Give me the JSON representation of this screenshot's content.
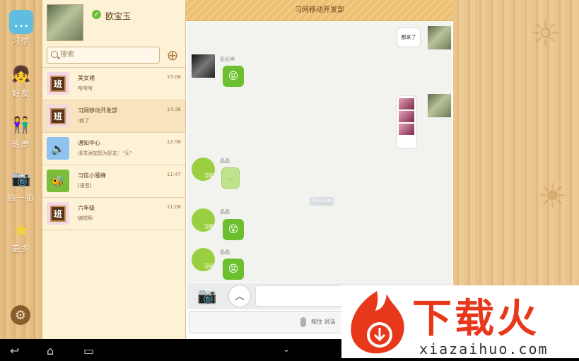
{
  "nav": {
    "items": [
      {
        "label": "习信",
        "icon": "chat-bubble-icon"
      },
      {
        "label": "好友",
        "icon": "girl-avatar-icon"
      },
      {
        "label": "班群",
        "icon": "group-avatar-icon"
      },
      {
        "label": "拍一拍",
        "icon": "camera-icon"
      },
      {
        "label": "更多",
        "icon": "star-icon"
      }
    ],
    "settings_icon": "gear-icon"
  },
  "profile": {
    "name": "欧宝玉",
    "search_placeholder": "搜索"
  },
  "conversations": [
    {
      "name": "美女裙",
      "time": "15:06",
      "preview": "哈哈哈",
      "avatar": "班"
    },
    {
      "name": "习网移动开发部",
      "time": "14:36",
      "preview": "/疯了",
      "avatar": "班"
    },
    {
      "name": "通知中心",
      "time": "12:56",
      "preview": "请求添加您为好友：\"无\"",
      "avatar": "speaker-icon"
    },
    {
      "name": "习信小蜜蜂",
      "time": "11:47",
      "preview": "[语音]",
      "avatar": "bee-icon"
    },
    {
      "name": "六年级",
      "time": "11:06",
      "preview": "嗨啦啊",
      "avatar": "班"
    }
  ],
  "chat": {
    "title": "习网移动开发部",
    "messages": {
      "m1_text": "都来了",
      "m2_sender": "彭长坤",
      "m4_sender": "晶晶",
      "m4_text": "...",
      "time_chip": "今天14:36",
      "m5_sender": "晶晶",
      "m6_sender": "晶晶"
    },
    "bee_label": "习网",
    "hold_to_talk": "按住 说话"
  },
  "watermark": {
    "title": "下载火",
    "sub": "xiazaihuo.com"
  }
}
